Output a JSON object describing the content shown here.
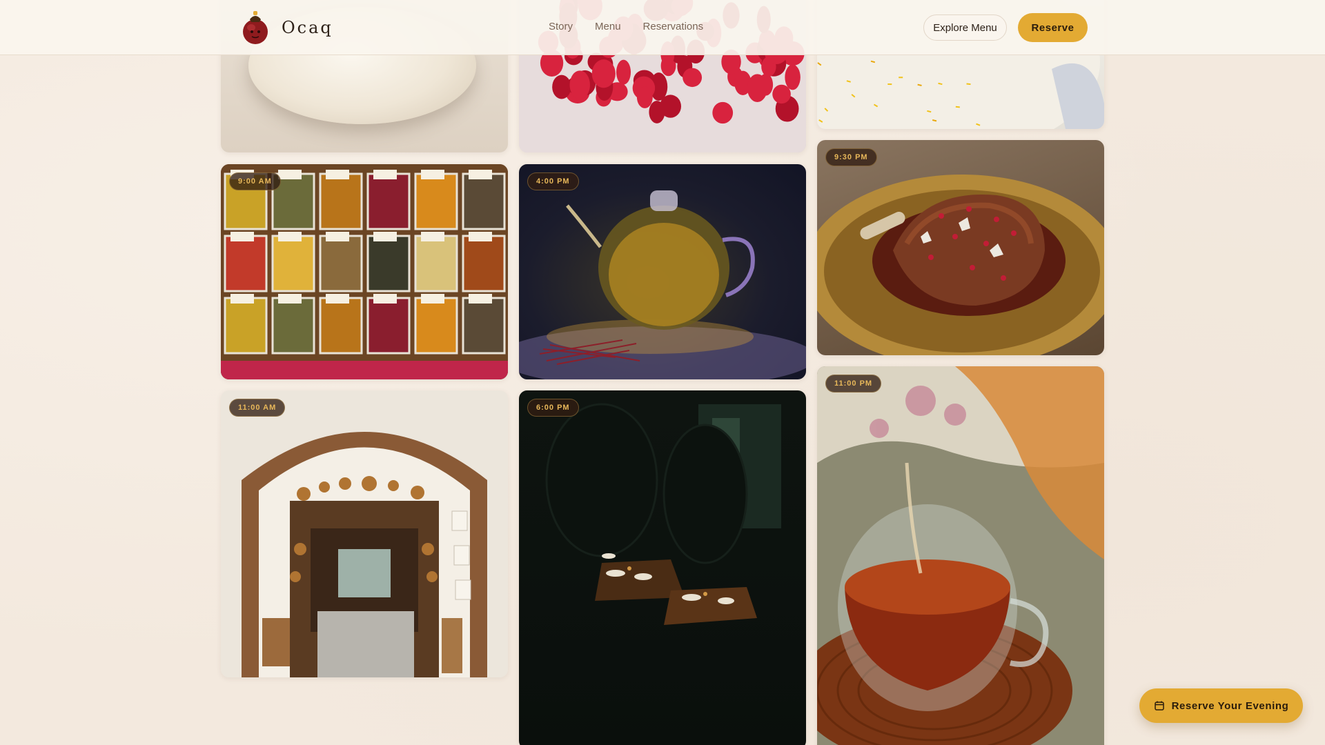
{
  "brand": {
    "name": "Ocaq"
  },
  "nav": {
    "items": [
      "Story",
      "Menu",
      "Reservations"
    ]
  },
  "header_actions": {
    "explore": "Explore Menu",
    "reserve": "Reserve"
  },
  "timeline": [
    {
      "time": "",
      "subject": "bread-dough"
    },
    {
      "time": "",
      "subject": "pomegranate-seeds"
    },
    {
      "time": "",
      "subject": "saffron-rice"
    },
    {
      "time": "9:00 AM",
      "subject": "spice-market"
    },
    {
      "time": "4:00 PM",
      "subject": "saffron-teapot"
    },
    {
      "time": "9:30 PM",
      "subject": "lamb-shank"
    },
    {
      "time": "11:00 AM",
      "subject": "copperware-shop"
    },
    {
      "time": "6:00 PM",
      "subject": "candlelit-dining-room"
    },
    {
      "time": "11:00 PM",
      "subject": "tea-pour"
    }
  ],
  "cta": {
    "label": "Reserve Your Evening",
    "icon": "calendar-icon"
  },
  "colors": {
    "accent": "#e3aa33",
    "background": "#f3e9de",
    "text": "#2d2118",
    "badge_text": "#e8b85a"
  }
}
